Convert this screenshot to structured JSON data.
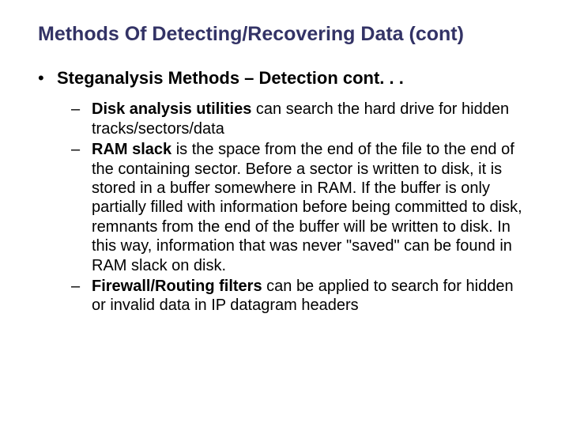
{
  "title": "Methods Of Detecting/Recovering Data (cont)",
  "l1_bullet": "•",
  "l1_text": "Steganalysis Methods – Detection cont. . .",
  "dash": "–",
  "sub1_term": "Disk analysis utilities",
  "sub1_rest": " can search the hard drive for hidden tracks/sectors/data",
  "sub2_term": "RAM slack",
  "sub2_rest": " is the space from the end of the file to the end of the containing sector. Before a sector is written to disk, it is stored in a buffer somewhere in RAM. If the buffer is only partially filled with information before being committed to disk, remnants from the end of the buffer will be written to disk. In this way, information that was never \"saved\" can be found in RAM slack on disk.",
  "sub3_term": "Firewall/Routing filters",
  "sub3_rest": " can be applied to search for hidden or invalid data in IP datagram headers"
}
